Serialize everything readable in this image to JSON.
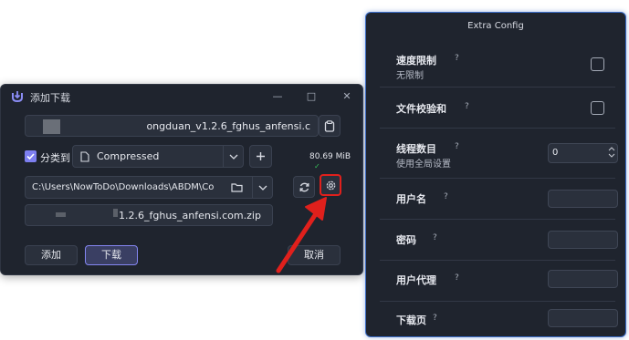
{
  "dialog": {
    "title": "添加下载",
    "url_value": "ongduan_v1.2.6_fghus_anfensi.c",
    "category_checkbox_label": "分类到",
    "category_value": "Compressed",
    "file_size": "80.69 MiB",
    "save_path": "C:\\Users\\NowToDo\\Downloads\\ABDM\\Compre",
    "file_name": "1.2.6_fghus_anfensi.com.zip",
    "add_button": "添加",
    "download_button": "下载",
    "cancel_button": "取消"
  },
  "extra_config": {
    "title": "Extra Config",
    "speed_limit": {
      "label": "速度限制",
      "sub": "无限制"
    },
    "file_checksum": {
      "label": "文件校验和"
    },
    "thread_count": {
      "label": "线程数目",
      "sub": "使用全局设置",
      "value": "0"
    },
    "username": {
      "label": "用户名"
    },
    "password": {
      "label": "密码"
    },
    "user_agent": {
      "label": "用户代理"
    },
    "download_page": {
      "label": "下载页"
    },
    "help_mark": "?"
  },
  "colors": {
    "accent": "#7d7ff0",
    "panel_border": "#3b6cc6",
    "highlight_red": "#e0201c",
    "success_green": "#36c25a"
  }
}
